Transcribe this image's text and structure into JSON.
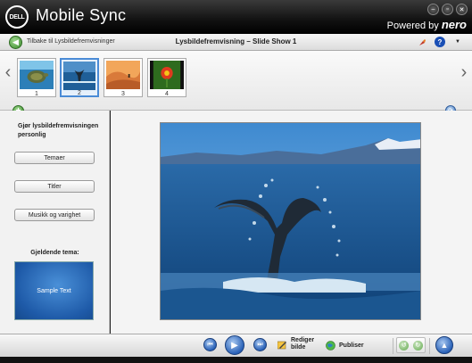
{
  "titlebar": {
    "logo_text": "DELL",
    "app_title": "Mobile Sync",
    "powered_by": "Powered by",
    "brand": "nero",
    "buttons": [
      "minimize",
      "maximize",
      "close"
    ]
  },
  "navbar": {
    "back_label": "Tilbake til Lysbildefremvisninger",
    "title": "Lysbildefremvisning – Slide Show 1"
  },
  "filmstrip": {
    "thumbnails": [
      {
        "number": "1",
        "subject": "sea turtle"
      },
      {
        "number": "2",
        "subject": "whale tail",
        "selected": true
      },
      {
        "number": "3",
        "subject": "desert dunes"
      },
      {
        "number": "4",
        "subject": "flower"
      }
    ]
  },
  "leftpanel": {
    "heading": "Gjør lysbildefremvisningen personlig",
    "buttons": [
      "Temaer",
      "Titler",
      "Musikk og varighet"
    ],
    "theme_label": "Gjeldende tema:",
    "sample_text": "Sample Text"
  },
  "bottombar": {
    "edit_label_1": "Rediger",
    "edit_label_2": "bilde",
    "publish_label": "Publiser"
  },
  "colors": {
    "accent_blue": "#2a62b8",
    "green": "#3a8a2a",
    "titlebar": "#111111"
  }
}
